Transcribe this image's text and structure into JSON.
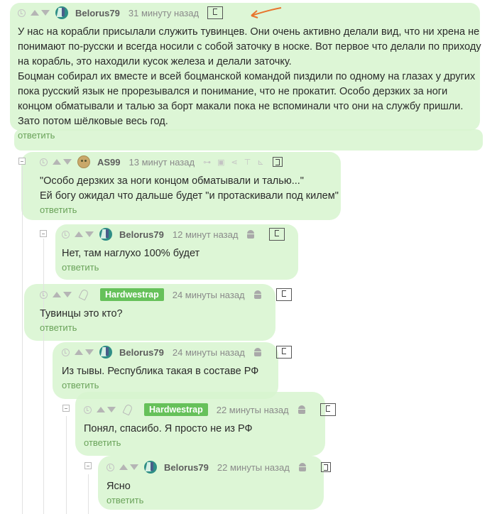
{
  "comments": [
    {
      "author": "Belorus79",
      "time": "31 минуту назад",
      "lines": [
        "У нас на корабли присылали служить тувинцев. Они очень активно делали вид, что ни хрена не",
        "понимают по-русски и всегда носили с собой заточку в носке. Вот первое что делали по приходу",
        "на корабль, это находили кусок железа и делали заточку.",
        "Боцман собирал их вместе и всей боцманской командой пиздили по одному на глазах у других",
        "пока русский язык не прорезывался и понимание, что не прокатит. Особо дерзких за ноги",
        "концом обматывали и талью за борт макали пока не вспоминали что они на службу пришли.",
        "Зато потом шёлковые весь год."
      ],
      "reply": "ответить"
    },
    {
      "author": "AS99",
      "time": "13 минут назад",
      "lines": [
        "\"Особо дерзких за ноги концом обматывали и талью...\"",
        "Ей богу ожидал что дальше будет \"и протаскивали под килем\""
      ],
      "reply": "ответить"
    },
    {
      "author": "Belorus79",
      "time": "12 минут назад",
      "lines": [
        "Нет, там наглухо 100% будет"
      ],
      "reply": "ответить"
    },
    {
      "author": "Hardwestrap",
      "time": "24 минуты назад",
      "lines": [
        "Тувинцы это кто?"
      ],
      "reply": "ответить"
    },
    {
      "author": "Belorus79",
      "time": "24 минуты назад",
      "lines": [
        "Из тывы. Республика такая в составе РФ"
      ],
      "reply": "ответить"
    },
    {
      "author": "Hardwestrap",
      "time": "22 минуты назад",
      "lines": [
        "Понял, спасибо. Я просто не из РФ"
      ],
      "reply": "ответить"
    },
    {
      "author": "Belorus79",
      "time": "22 минуты назад",
      "lines": [
        "Ясно"
      ],
      "reply": "ответить"
    }
  ],
  "icons": {
    "clock": "clock-icon",
    "upvote": "upvote-icon",
    "downvote": "downvote-icon",
    "android": "android-icon",
    "collapse": "collapse-icon"
  },
  "colors": {
    "highlight": "#d7f5cf",
    "badge": "#66c15a",
    "reply_link": "#6aa35a",
    "annotation_arrow": "#e8742c"
  }
}
